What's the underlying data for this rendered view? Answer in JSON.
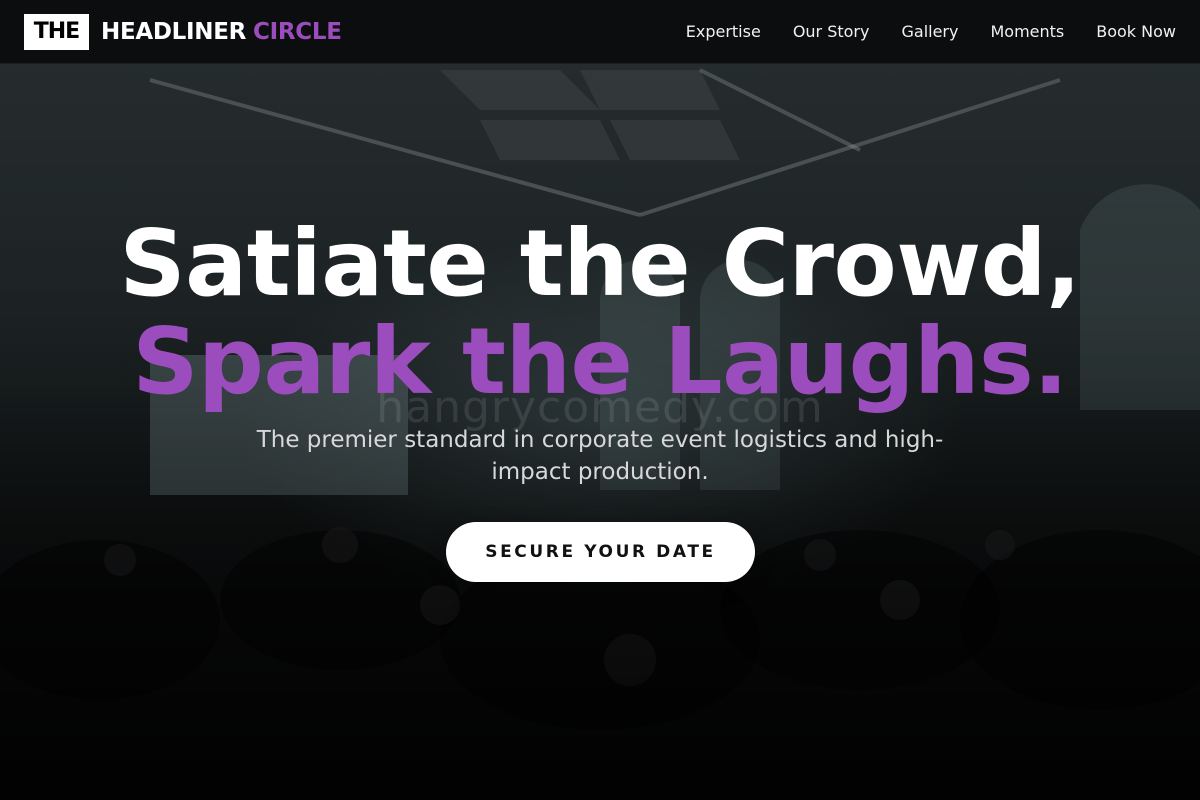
{
  "brand": {
    "logo_box": "THE",
    "name": "HEADLINER",
    "accent_word": "CIRCLE",
    "accent_color": "#9b4dbd"
  },
  "nav": {
    "items": [
      {
        "label": "Expertise"
      },
      {
        "label": "Our Story"
      },
      {
        "label": "Gallery"
      },
      {
        "label": "Moments"
      },
      {
        "label": "Book Now"
      }
    ]
  },
  "hero": {
    "headline_line1": "Satiate the Crowd,",
    "headline_line2": "Spark the Laughs.",
    "subtitle": "The premier standard in corporate event logistics and high-impact production.",
    "cta_label": "SECURE YOUR DATE",
    "background_image": "venue-crowd-photo",
    "watermark_text": "hangrycomedy.com"
  }
}
